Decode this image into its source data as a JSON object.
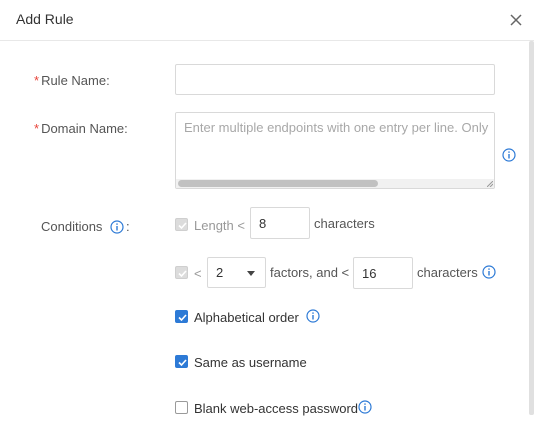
{
  "dialog": {
    "title": "Add Rule"
  },
  "form": {
    "rule_name": {
      "label": "Rule Name:",
      "required_mark": "*",
      "value": ""
    },
    "domain_name": {
      "label": "Domain Name:",
      "required_mark": "*",
      "value": "",
      "placeholder": "Enter multiple endpoints with one entry per line. Only"
    },
    "conditions": {
      "label": "Conditions",
      "colon": ":",
      "length": {
        "checked": true,
        "disabled": true,
        "prefix": "Length <",
        "value": "8",
        "suffix": "characters"
      },
      "factors": {
        "checked": true,
        "disabled": true,
        "prefix": "<",
        "selected": "2",
        "middle": "factors, and <",
        "value": "16",
        "suffix": "characters"
      },
      "alphabetical_order": {
        "label": "Alphabetical order",
        "checked": true
      },
      "same_as_username": {
        "label": "Same as username",
        "checked": true
      },
      "blank_password": {
        "label": "Blank web-access password",
        "checked": false
      }
    }
  },
  "colors": {
    "accent": "#2d7ad6",
    "required": "#e8443a",
    "border": "#d9d9d9",
    "muted_text": "#999999"
  },
  "icons": [
    "close-icon",
    "info-icon",
    "check-icon",
    "chevron-down-icon"
  ]
}
